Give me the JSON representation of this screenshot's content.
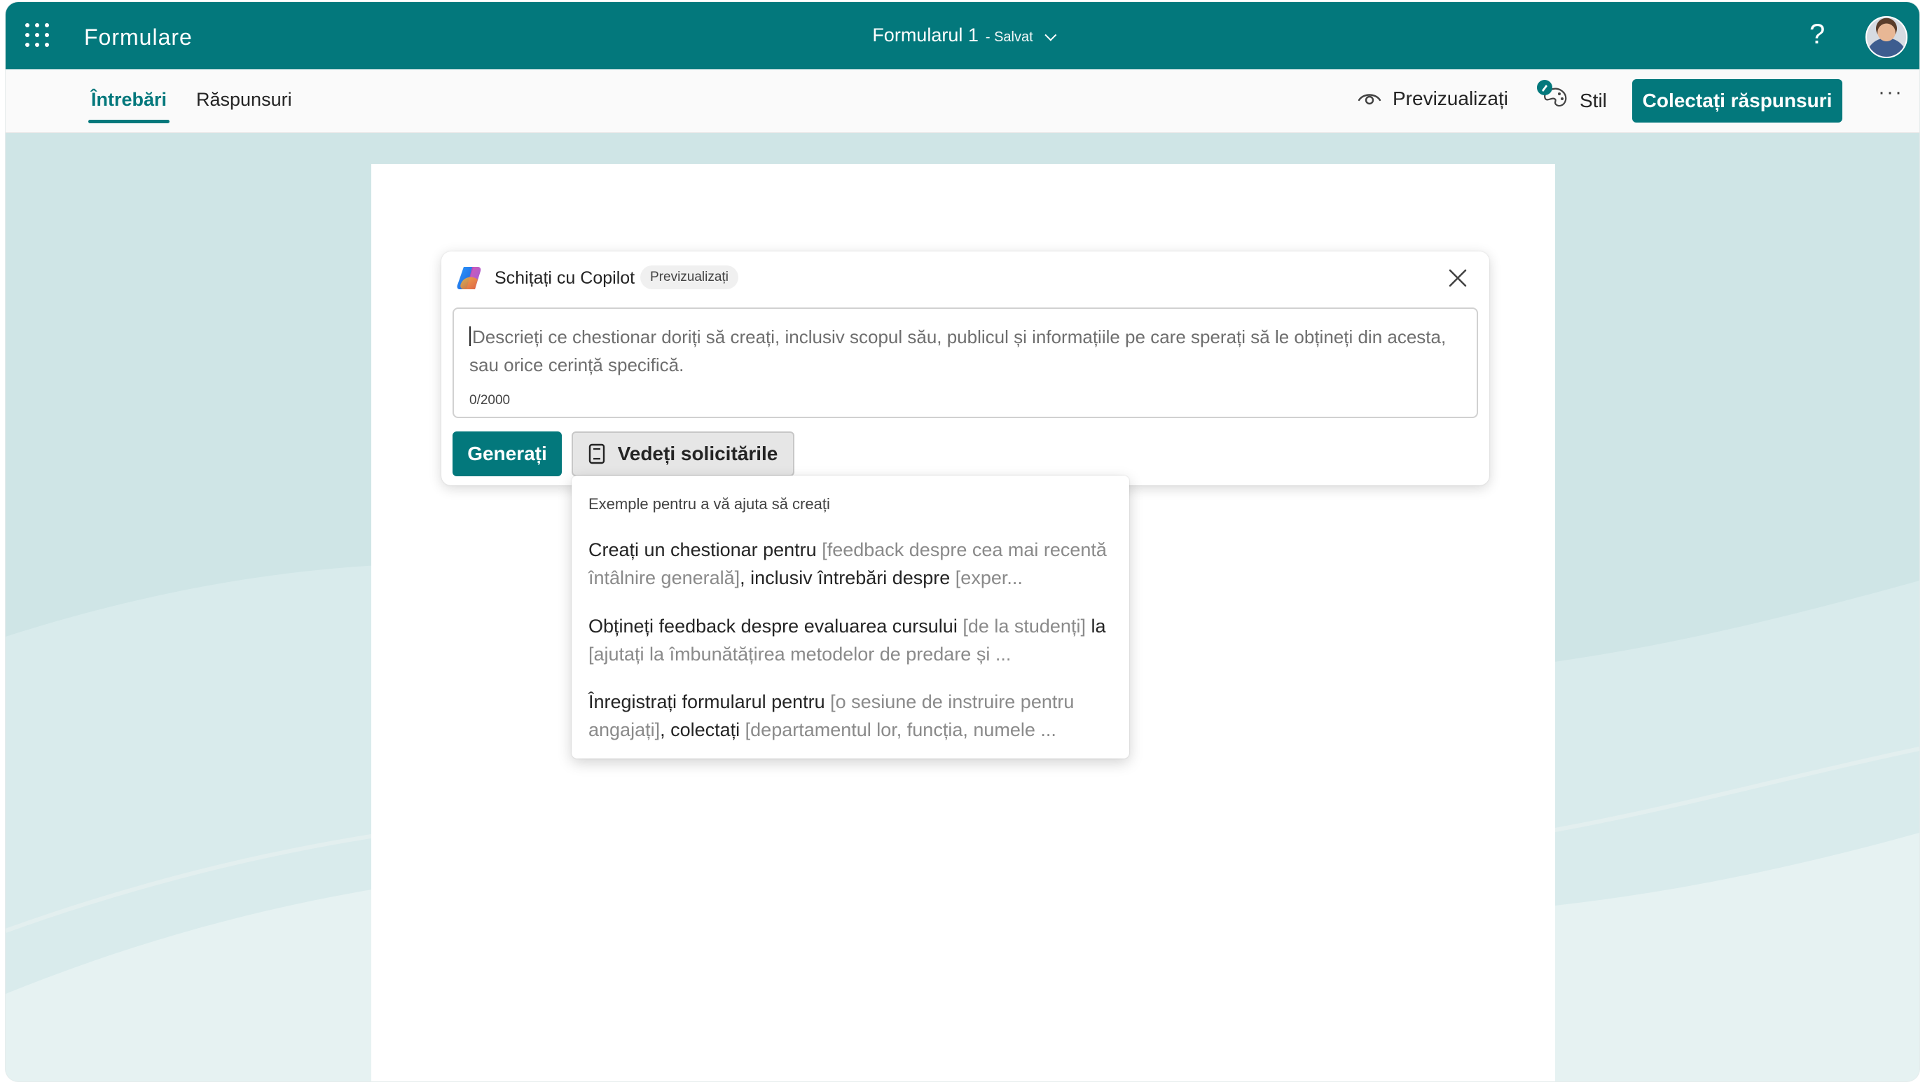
{
  "app": {
    "name": "Formulare",
    "document_title": "Formularul 1",
    "saved_status": "- Salvat",
    "help_label": "?"
  },
  "tabs": [
    {
      "label": "Întrebări",
      "active": true
    },
    {
      "label": "Răspunsuri",
      "active": false
    }
  ],
  "toolbar": {
    "preview_label": "Previzualizați",
    "style_label": "Stil",
    "collect_label": "Colectați răspunsuri",
    "more_label": "···"
  },
  "copilot": {
    "title": "Schițați cu Copilot",
    "badge": "Previzualizați",
    "placeholder": "Descrieți ce chestionar doriți să creați, inclusiv scopul său, publicul și informațiile pe care sperați să le obțineți din acesta, sau orice cerință specifică.",
    "char_count": "0/2000",
    "generate_label": "Generați",
    "view_prompts_label": "Vedeți solicitările"
  },
  "prompt_menu": {
    "header": "Exemple pentru a vă ajuta să creați",
    "items": [
      {
        "p1": "Creați un chestionar pentru ",
        "p2": "[feedback despre cea mai recentă întâlnire generală]",
        "p3": ", inclusiv întrebări despre ",
        "p4": "[exper..."
      },
      {
        "p1": "Obțineți feedback despre evaluarea cursului ",
        "p2": "[de la studenți]",
        "p3": " la ",
        "p4": "[ajutați la îmbunătățirea metodelor de predare și ..."
      },
      {
        "p1": "Înregistrați formularul pentru ",
        "p2": "[o sesiune de instruire pentru angajați]",
        "p3": ", colectați ",
        "p4": "[departamentul lor, funcția, numele ..."
      }
    ]
  },
  "colors": {
    "brand": "#03787c",
    "canvas_bg": "#cfe5e6"
  }
}
